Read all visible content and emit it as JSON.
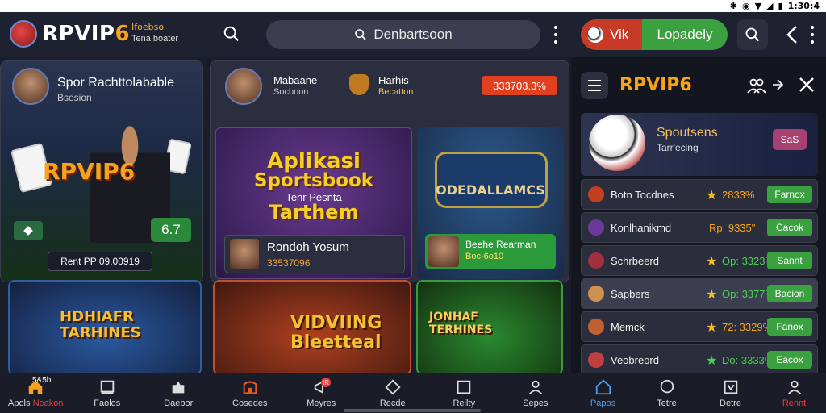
{
  "statusbar": {
    "time": "1:30:4"
  },
  "header": {
    "logo_text_a": "RPVIP",
    "logo_text_b": "6",
    "logo_sub1": "Ifoebso",
    "logo_sub2": "Tena boater",
    "search_text": "Denbartsoon"
  },
  "right_panel": {
    "vik_label": "Vik",
    "lopad_label": "Lopadely",
    "title": "RPVIP6",
    "hero": {
      "title": "Spoutsens",
      "sub": "Tarr'ecing",
      "badge": "SaS"
    },
    "rows": [
      {
        "name": "Botn Tocdnes",
        "pct": "2833%",
        "btn": "Farnox"
      },
      {
        "name": "Konlhanikmd",
        "pct": "Rp: 9335\"",
        "btn": "Cacok"
      },
      {
        "name": "Schrbeerd",
        "pct": "Op: 3323%",
        "btn": "Sannt"
      },
      {
        "name": "Sapbers",
        "pct": "Op: 3377%",
        "btn": "Bacion"
      },
      {
        "name": "Memck",
        "pct": "72: 3329%",
        "btn": "Fanox"
      },
      {
        "name": "Veobreord",
        "pct": "Do: 3333%",
        "btn": "Eacox"
      }
    ]
  },
  "hero_left": {
    "title": "Spor Rachttolabable",
    "sub": "Bsesion",
    "brand": "RPVIP6",
    "odds": "6.7",
    "foot": "Rent PP 09.00919"
  },
  "mid": {
    "name": "Mabaane",
    "name_sub": "Socboon",
    "ht": "Harhis",
    "ht_sub": "Becatton",
    "pill": "333703.3%",
    "promo1": {
      "l1": "Aplikasi",
      "l2": "Sportsbook",
      "l3": "Tenr Pesnta",
      "l4": "Tarthem",
      "box_title": "Rondoh Yosum",
      "box_sub": "33537096"
    },
    "promo2": {
      "logo_text": "ODEDALLAMCS",
      "box_title": "Beehe Rearman",
      "box_sub": "Boc-6o10"
    }
  },
  "bottom_cards": [
    {
      "text1": "HDHIAFR",
      "text2": "TARHINES"
    },
    {
      "text1": "VIDVIING",
      "text2": "Bleetteal"
    },
    {
      "text1": "JONHAF",
      "text2": "TERHINES"
    }
  ],
  "nav": [
    {
      "label_a": "Apols",
      "label_b": "Neakon",
      "badge": "5&5b"
    },
    {
      "label": "Faolos"
    },
    {
      "label": "Daebor"
    },
    {
      "label": "Cosedes"
    },
    {
      "label": "Meyres",
      "badge": "IR"
    },
    {
      "label": "Recde"
    },
    {
      "label": "Reilty"
    },
    {
      "label": "Sepes"
    }
  ],
  "nav2": [
    {
      "label": "Papos"
    },
    {
      "label": "Tetre"
    },
    {
      "label": "Detre"
    },
    {
      "label": "Rennt"
    }
  ]
}
